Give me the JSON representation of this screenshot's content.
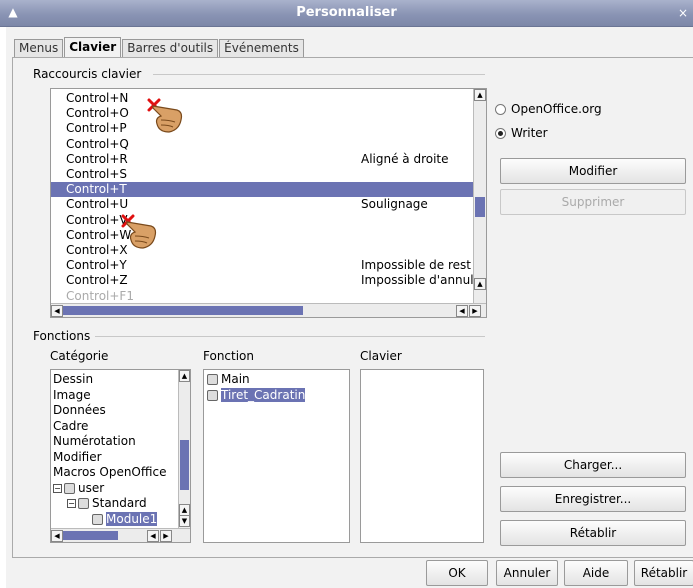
{
  "window": {
    "title": "Personnaliser"
  },
  "tabs": [
    {
      "label": "Menus"
    },
    {
      "label": "Clavier",
      "active": true
    },
    {
      "label": "Barres d'outils"
    },
    {
      "label": "Événements"
    }
  ],
  "shortcuts": {
    "group_label": "Raccourcis clavier",
    "rows": [
      {
        "key": "Control+N",
        "func": ""
      },
      {
        "key": "Control+O",
        "func": ""
      },
      {
        "key": "Control+P",
        "func": ""
      },
      {
        "key": "Control+Q",
        "func": ""
      },
      {
        "key": "Control+R",
        "func": "Aligné à droite"
      },
      {
        "key": "Control+S",
        "func": ""
      },
      {
        "key": "Control+T",
        "func": "",
        "selected": true
      },
      {
        "key": "Control+U",
        "func": "Soulignage"
      },
      {
        "key": "Control+V",
        "func": ""
      },
      {
        "key": "Control+W",
        "func": ""
      },
      {
        "key": "Control+X",
        "func": ""
      },
      {
        "key": "Control+Y",
        "func": "Impossible de rest"
      },
      {
        "key": "Control+Z",
        "func": "Impossible d'annul"
      },
      {
        "key": "Control+F1",
        "func": ""
      }
    ]
  },
  "scope": {
    "options": [
      {
        "label": "OpenOffice.org",
        "checked": false
      },
      {
        "label": "Writer",
        "checked": true
      }
    ]
  },
  "buttons": {
    "modify": "Modifier",
    "delete": "Supprimer",
    "load": "Charger...",
    "save": "Enregistrer...",
    "reset": "Rétablir"
  },
  "functions": {
    "group_label": "Fonctions",
    "category_header": "Catégorie",
    "function_header": "Fonction",
    "keys_header": "Clavier",
    "categories": [
      "Dessin",
      "Image",
      "Données",
      "Cadre",
      "Numérotation",
      "Modifier",
      "Macros OpenOffice"
    ],
    "tree": [
      {
        "label": "user",
        "level": 0,
        "expander": "⊟"
      },
      {
        "label": "Standard",
        "level": 1,
        "expander": "⊟"
      },
      {
        "label": "Module1",
        "level": 2,
        "selected": true
      }
    ],
    "function_items": [
      {
        "label": "Main",
        "selected": false
      },
      {
        "label": "Tiret_Cadratin",
        "selected": true
      }
    ]
  },
  "footer": {
    "ok": "OK",
    "cancel": "Annuler",
    "help": "Aide",
    "reset": "Rétablir"
  },
  "colors": {
    "selection": "#6b73b3",
    "titlebar": "#8a94b4"
  }
}
